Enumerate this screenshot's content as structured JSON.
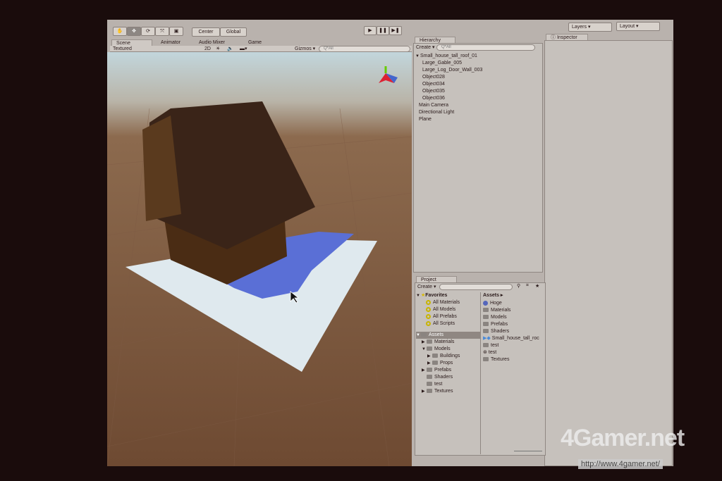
{
  "toolbar": {
    "tools": [
      "hand",
      "move",
      "rotate",
      "scale",
      "rect"
    ],
    "pivot": "Center",
    "space": "Global",
    "layers": "Layers",
    "layout": "Layout"
  },
  "scene_tabs": [
    "Scene",
    "Animator",
    "Audio Mixer",
    "Game"
  ],
  "scene_toolbar": {
    "shading": "Textured",
    "mode_2d": "2D",
    "gizmos": "Gizmos",
    "search": "Q*All"
  },
  "hierarchy": {
    "title": "Hierarchy",
    "create": "Create",
    "search": "Q*All",
    "items": [
      {
        "label": "Small_house_tall_roof_01",
        "indent": 0,
        "expanded": true
      },
      {
        "label": "Large_Gable_005",
        "indent": 2
      },
      {
        "label": "Large_Log_Door_Wall_003",
        "indent": 2
      },
      {
        "label": "Object028",
        "indent": 2
      },
      {
        "label": "Object034",
        "indent": 2
      },
      {
        "label": "Object035",
        "indent": 2
      },
      {
        "label": "Object036",
        "indent": 2
      },
      {
        "label": "Main Camera",
        "indent": 1
      },
      {
        "label": "Directional Light",
        "indent": 1
      },
      {
        "label": "Plane",
        "indent": 1
      }
    ]
  },
  "inspector": {
    "title": "Inspector"
  },
  "project": {
    "title": "Project",
    "create": "Create",
    "favorites_label": "Favorites",
    "favorites": [
      "All Materials",
      "All Models",
      "All Prefabs",
      "All Scripts"
    ],
    "assets_label": "Assets",
    "tree": [
      {
        "label": "Materials",
        "indent": 1,
        "arrow": "▶"
      },
      {
        "label": "Models",
        "indent": 1,
        "arrow": "▼"
      },
      {
        "label": "Buildings",
        "indent": 2,
        "arrow": "▶"
      },
      {
        "label": "Props",
        "indent": 2,
        "arrow": "▶"
      },
      {
        "label": "Prefabs",
        "indent": 1,
        "arrow": "▶"
      },
      {
        "label": "Shaders",
        "indent": 1,
        "arrow": ""
      },
      {
        "label": "test",
        "indent": 1,
        "arrow": ""
      },
      {
        "label": "Textures",
        "indent": 1,
        "arrow": "▶"
      }
    ],
    "breadcrumb": "Assets ▸",
    "grid": [
      "Hoge",
      "Materials",
      "Models",
      "Prefabs",
      "Shaders",
      "Small_house_tall_roc",
      "test",
      "test",
      "Textures"
    ]
  },
  "watermark": {
    "logo": "4Gamer.net",
    "url": "http://www.4gamer.net/"
  }
}
